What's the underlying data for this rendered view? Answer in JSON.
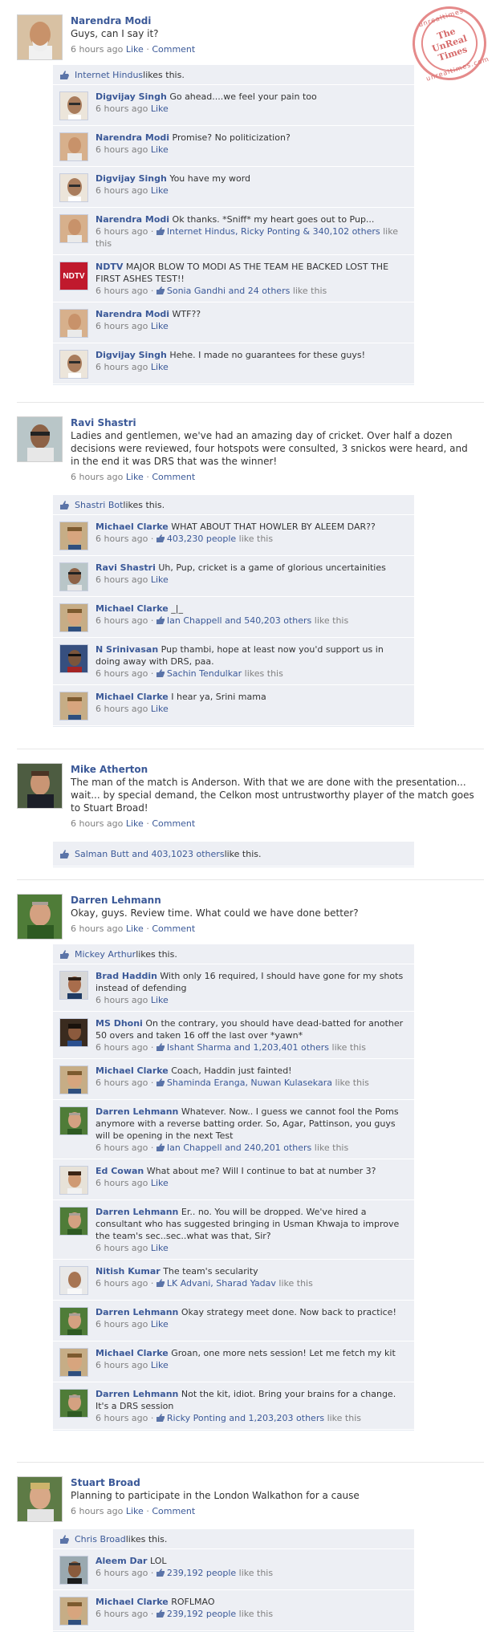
{
  "stamp": {
    "line1": "The",
    "line2": "UnReal",
    "line3": "Times",
    "ring_top": "unrealtimes",
    "ring_bottom": "unrealtimes.com"
  },
  "common": {
    "like": "Like",
    "comment": "Comment",
    "sep": "·"
  },
  "posts": [
    {
      "author": "Narendra Modi",
      "text": "Guys, can I say it?",
      "time": "6 hours ago",
      "likes": {
        "who": "Internet Hindus",
        "suffix": " likes this."
      },
      "comments": [
        {
          "author": "Digvijay Singh",
          "text": "Go ahead....we feel your pain too",
          "time": "6 hours ago",
          "like": "Like"
        },
        {
          "author": "Narendra Modi",
          "text": "Promise? No politicization?",
          "time": "6 hours ago",
          "like": "Like"
        },
        {
          "author": "Digvijay Singh",
          "text": "You have my word",
          "time": "6 hours ago",
          "like": "Like"
        },
        {
          "author": "Narendra Modi",
          "text": "Ok thanks. *Sniff* my heart goes out to Pup...",
          "time": "6 hours ago",
          "likers": "Internet Hindus, Ricky Ponting & 340,102 others",
          "likers_suffix": " like this"
        },
        {
          "author": "NDTV",
          "text": "MAJOR BLOW TO MODI AS THE TEAM HE BACKED LOST THE FIRST ASHES TEST!!",
          "time": "6 hours ago",
          "likers": "Sonia Gandhi and 24 others",
          "likers_suffix": " like this",
          "avatar_text": "NDTV"
        },
        {
          "author": "Narendra Modi",
          "text": "WTF??",
          "time": "6 hours ago",
          "like": "Like"
        },
        {
          "author": "Digvijay Singh",
          "text": "Hehe. I made no guarantees for these guys!",
          "time": "6 hours ago",
          "like": "Like"
        }
      ]
    },
    {
      "author": "Ravi Shastri",
      "text": "Ladies and gentlemen, we've had an amazing day of cricket. Over half a dozen decisions were reviewed, four hotspots were consulted, 3 snickos were heard, and in the end it was DRS that was the winner!",
      "time": "6 hours ago",
      "likes": {
        "who": "Shastri Bot",
        "suffix": " likes this."
      },
      "comments": [
        {
          "author": "Michael Clarke",
          "text": "WHAT ABOUT THAT HOWLER BY ALEEM DAR??",
          "time": "6 hours ago",
          "likers": "403,230 people",
          "likers_suffix": " like this"
        },
        {
          "author": "Ravi Shastri",
          "text": "Uh, Pup, cricket is a game of glorious uncertainities",
          "time": "6 hours ago",
          "like": "Like"
        },
        {
          "author": "Michael Clarke",
          "text": "_|_",
          "time": "6 hours ago",
          "likers": "Ian Chappell and 540,203 others",
          "likers_suffix": " like this"
        },
        {
          "author": "N Srinivasan",
          "text": "Pup thambi, hope at least now you'd support us in doing away with DRS, paa.",
          "time": "6 hours ago",
          "likers": "Sachin Tendulkar",
          "likers_suffix": " likes this"
        },
        {
          "author": "Michael Clarke",
          "text": "I hear ya, Srini mama",
          "time": "6 hours ago",
          "like": "Like"
        }
      ]
    },
    {
      "author": "Mike Atherton",
      "text": "The man of the match is Anderson. With that we are done with the presentation... wait... by special demand, the Celkon most untrustworthy player of the match goes to Stuart Broad!",
      "time": "6 hours ago",
      "likes": {
        "who": "Salman Butt and 403,1023 others",
        "suffix": " like this."
      },
      "comments": []
    },
    {
      "author": "Darren Lehmann",
      "text": "Okay, guys. Review time. What could we have done better?",
      "time": "6 hours ago",
      "likes": {
        "who": "Mickey Arthur",
        "suffix": " likes this."
      },
      "comments": [
        {
          "author": "Brad Haddin",
          "text": "With only 16 required, I should have gone for my shots instead of defending",
          "time": "6 hours ago",
          "like": "Like"
        },
        {
          "author": "MS Dhoni",
          "text": "On the contrary, you should have dead-batted for another 50 overs and taken 16 off the last over *yawn*",
          "time": "6 hours ago",
          "likers": "Ishant Sharma and 1,203,401 others",
          "likers_suffix": " like this"
        },
        {
          "author": "Michael Clarke",
          "text": "Coach, Haddin just fainted!",
          "time": "6 hours ago",
          "likers": "Shaminda Eranga, Nuwan Kulasekara",
          "likers_suffix": " like this"
        },
        {
          "author": "Darren Lehmann",
          "text": "Whatever. Now.. I guess we cannot fool the Poms anymore with a reverse batting order. So, Agar, Pattinson, you guys will be opening in the next Test",
          "time": "6 hours ago",
          "likers": "Ian Chappell and 240,201 others",
          "likers_suffix": " like this"
        },
        {
          "author": "Ed Cowan",
          "text": "What about me? Will I continue to bat at number 3?",
          "time": "6 hours ago",
          "like": "Like"
        },
        {
          "author": "Darren Lehmann",
          "text": "Er.. no. You will be dropped. We've hired a consultant who has suggested bringing in Usman Khwaja to improve the team's sec..sec..what was that, Sir?",
          "time": "6 hours ago",
          "like": "Like"
        },
        {
          "author": "Nitish Kumar",
          "text": "The team's secularity",
          "time": "6 hours ago",
          "likers": "LK Advani, Sharad Yadav",
          "likers_suffix": " like this"
        },
        {
          "author": "Darren Lehmann",
          "text": "Okay strategy meet done. Now back to practice!",
          "time": "6 hours ago",
          "like": "Like"
        },
        {
          "author": "Michael Clarke",
          "text": "Groan, one more nets session! Let me fetch my kit",
          "time": "6 hours ago",
          "like": "Like"
        },
        {
          "author": "Darren Lehmann",
          "text": "Not the kit, idiot. Bring your brains for a change. It's a DRS session",
          "time": "6 hours ago",
          "likers": "Ricky Ponting and 1,203,203 others",
          "likers_suffix": " like this"
        }
      ]
    },
    {
      "author": "Stuart Broad",
      "text": "Planning to participate in the London Walkathon for a cause",
      "time": "6 hours ago",
      "likes": {
        "who": "Chris Broad",
        "suffix": " likes this."
      },
      "comments": [
        {
          "author": "Aleem Dar",
          "text": "LOL",
          "time": "6 hours ago",
          "likers": "239,192 people",
          "likers_suffix": " like this"
        },
        {
          "author": "Michael Clarke",
          "text": "ROFLMAO",
          "time": "6 hours ago",
          "likers": "239,192 people",
          "likers_suffix": " like this"
        }
      ]
    }
  ],
  "colors": {
    "link": "#3b5998",
    "muted": "#808080",
    "panel": "#edeff4",
    "stamp": "#d66a6a"
  }
}
